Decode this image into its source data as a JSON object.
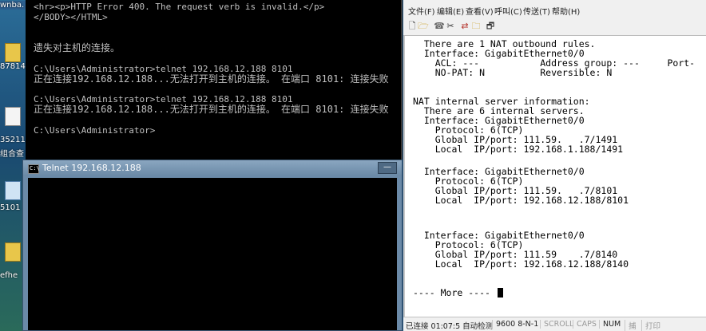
{
  "desktop": {
    "icons": [
      {
        "label": "wnba.",
        "icon": "text-file-icon"
      },
      {
        "label": "87814.",
        "icon": "folder-icon"
      },
      {
        "label": "35211.",
        "icon": "document-icon"
      },
      {
        "label": "组合查",
        "icon": "folder-icon"
      },
      {
        "label": "5101",
        "icon": "shortcut-icon"
      },
      {
        "label": "efhe",
        "icon": "folder-icon"
      }
    ]
  },
  "cmd": {
    "lines": [
      "<hr><p>HTTP Error 400. The request verb is invalid.</p>",
      "</BODY></HTML>",
      "",
      "遗失对主机的连接。",
      "",
      "C:\\Users\\Administrator>telnet 192.168.12.188 8101",
      "正在连接192.168.12.188...无法打开到主机的连接。 在端口 8101: 连接失败",
      "",
      "C:\\Users\\Administrator>telnet 192.168.12.188 8101",
      "正在连接192.168.12.188...无法打开到主机的连接。 在端口 8101: 连接失败",
      "",
      "C:\\Users\\Administrator>"
    ]
  },
  "telnet": {
    "title": "Telnet 192.168.12.188",
    "icon_label": "C:\\",
    "minimize": "—"
  },
  "terminal": {
    "menu": [
      "文件(F)",
      "编辑(E)",
      "查看(V)",
      "呼叫(C)",
      "传送(T)",
      "帮助(H)"
    ],
    "toolbar": [
      "new-icon",
      "open-icon",
      "call-icon",
      "disconnect-icon",
      "send-icon",
      "receive-icon",
      "properties-icon"
    ],
    "screen_lines": [
      "  There are 1 NAT outbound rules.",
      "  Interface: GigabitEthernet0/0",
      "    ACL: ---           Address group: ---     Port-",
      "    NO-PAT: N          Reversible: N",
      "",
      "NAT internal server information:",
      "  There are 6 internal servers.",
      "  Interface: GigabitEthernet0/0",
      "    Protocol: 6(TCP)",
      "    Global IP/port: 111.59.   .7/1491",
      "    Local  IP/port: 192.168.1.188/1491",
      "",
      "  Interface: GigabitEthernet0/0",
      "    Protocol: 6(TCP)",
      "    Global IP/port: 111.59.   .7/8101",
      "    Local  IP/port: 192.168.12.188/8101",
      "",
      "  Interface: GigabitEthernet0/0",
      "    Protocol: 6(TCP)",
      "    Global IP/port: 111.59    .7/8140",
      "    Local  IP/port: 192.168.12.188/8140",
      "",
      "",
      "---- More ----"
    ],
    "status": [
      {
        "text": "已连接 01:07:5 自动检测",
        "dim": false
      },
      {
        "text": "9600 8-N-1",
        "dim": false
      },
      {
        "text": "SCROLL",
        "dim": true
      },
      {
        "text": "CAPS",
        "dim": true
      },
      {
        "text": "NUM",
        "dim": false
      },
      {
        "text": "捕",
        "dim": true
      },
      {
        "text": "打印",
        "dim": true
      }
    ]
  }
}
